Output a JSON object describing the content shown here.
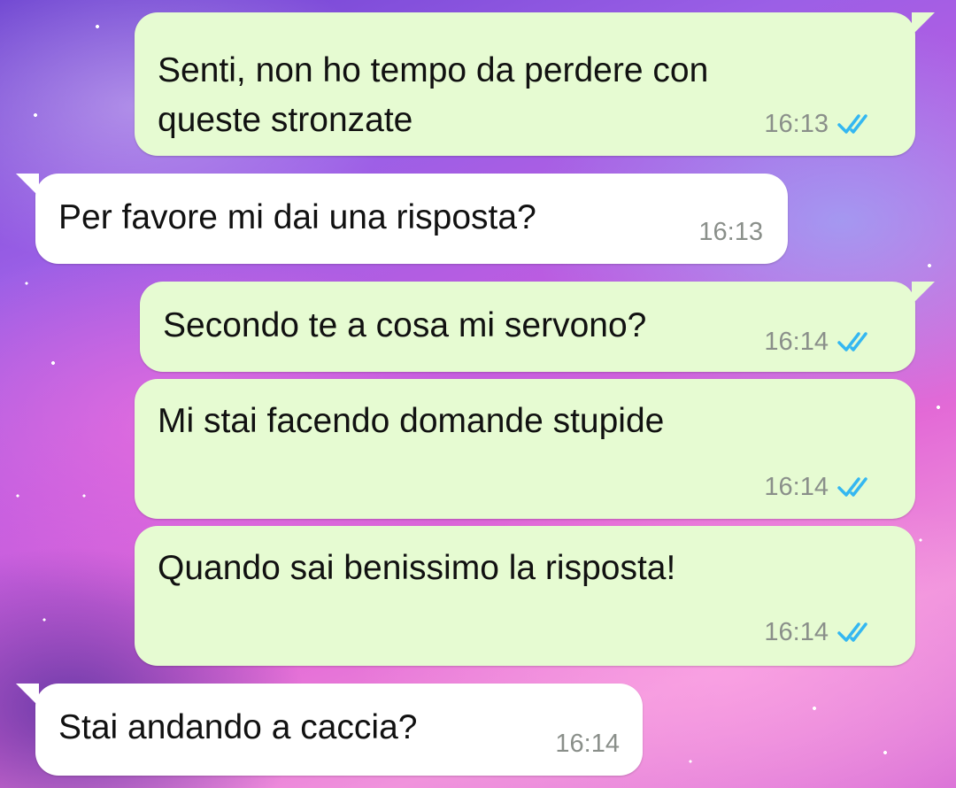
{
  "colors": {
    "outgoing_bubble": "#e6fbd2",
    "incoming_bubble": "#ffffff",
    "read_ticks": "#34b7f1",
    "timestamp": "#8a8f8a"
  },
  "messages": [
    {
      "direction": "outgoing",
      "text": "Senti, non ho tempo da perdere con\nqueste stronzate",
      "time": "16:13",
      "status": "read",
      "status_icon": "double-check-icon"
    },
    {
      "direction": "incoming",
      "text": "Per favore mi dai una risposta?",
      "time": "16:13"
    },
    {
      "direction": "outgoing",
      "text": "Secondo te a cosa mi servono?",
      "time": "16:14",
      "status": "read",
      "status_icon": "double-check-icon"
    },
    {
      "direction": "outgoing",
      "text": "Mi stai facendo domande stupide",
      "time": "16:14",
      "status": "read",
      "status_icon": "double-check-icon"
    },
    {
      "direction": "outgoing",
      "text": "Quando sai benissimo la risposta!",
      "time": "16:14",
      "status": "read",
      "status_icon": "double-check-icon"
    },
    {
      "direction": "incoming",
      "text": "Stai andando a caccia?",
      "time": "16:14"
    }
  ]
}
